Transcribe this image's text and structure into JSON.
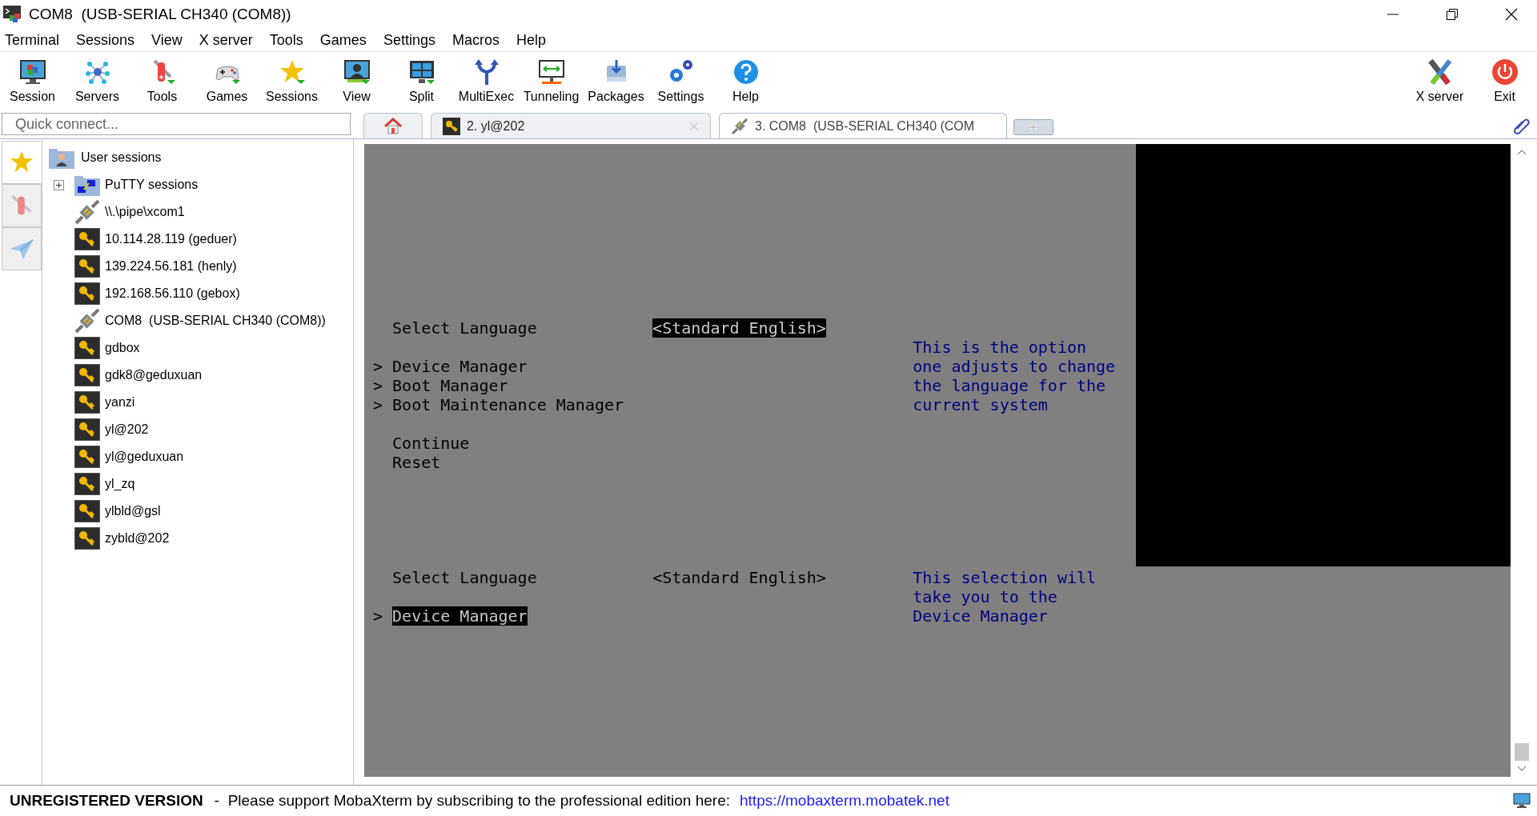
{
  "window": {
    "title": "COM8  (USB-SERIAL CH340 (COM8))"
  },
  "menu": [
    "Terminal",
    "Sessions",
    "View",
    "X server",
    "Tools",
    "Games",
    "Settings",
    "Macros",
    "Help"
  ],
  "toolbar": {
    "left": [
      {
        "label": "Session",
        "kind": "session"
      },
      {
        "label": "Servers",
        "kind": "servers"
      },
      {
        "label": "Tools",
        "kind": "tools"
      },
      {
        "label": "Games",
        "kind": "games"
      },
      {
        "label": "Sessions",
        "kind": "star"
      },
      {
        "label": "View",
        "kind": "view"
      },
      {
        "label": "Split",
        "kind": "split"
      },
      {
        "label": "MultiExec",
        "kind": "multiexec"
      },
      {
        "label": "Tunneling",
        "kind": "tunneling"
      },
      {
        "label": "Packages",
        "kind": "packages"
      },
      {
        "label": "Settings",
        "kind": "settings"
      },
      {
        "label": "Help",
        "kind": "help"
      }
    ],
    "right": [
      {
        "label": "X server",
        "kind": "xserver"
      },
      {
        "label": "Exit",
        "kind": "exit"
      }
    ]
  },
  "quick_connect": {
    "placeholder": "Quick connect..."
  },
  "side_tabs": [
    {
      "kind": "star",
      "selected": true
    },
    {
      "kind": "tools",
      "selected": false
    },
    {
      "kind": "send",
      "selected": false
    }
  ],
  "sessions_tree": {
    "label": "User sessions",
    "children": [
      {
        "label": "PuTTY sessions",
        "kind": "folder",
        "expanded": false
      },
      {
        "label": "\\\\.\\pipe\\xcom1",
        "kind": "serial"
      },
      {
        "label": "10.114.28.119 (geduer)",
        "kind": "ssh"
      },
      {
        "label": "139.224.56.181 (henly)",
        "kind": "ssh"
      },
      {
        "label": "192.168.56.110 (gebox)",
        "kind": "ssh"
      },
      {
        "label": "COM8  (USB-SERIAL CH340 (COM8))",
        "kind": "serial"
      },
      {
        "label": "gdbox",
        "kind": "ssh"
      },
      {
        "label": "gdk8@geduxuan",
        "kind": "ssh"
      },
      {
        "label": "yanzi",
        "kind": "ssh"
      },
      {
        "label": "yl@202",
        "kind": "ssh"
      },
      {
        "label": "yl@geduxuan",
        "kind": "ssh"
      },
      {
        "label": "yl_zq",
        "kind": "ssh"
      },
      {
        "label": "ylbld@gsl",
        "kind": "ssh"
      },
      {
        "label": "zybld@202",
        "kind": "ssh"
      }
    ]
  },
  "tabs": [
    {
      "kind": "home",
      "selected": false
    },
    {
      "label": "2. yl@202",
      "kind": "ssh",
      "selected": false
    },
    {
      "label": "3. COM8  (USB-SERIAL CH340 (COM",
      "kind": "serial",
      "selected": true
    }
  ],
  "terminal": {
    "rows": [
      {
        "kind": "text",
        "label": "Select Language",
        "label_highlighted": false,
        "value": "<Standard English>",
        "value_highlighted": true
      },
      {
        "kind": "text",
        "help": "This is the option"
      },
      {
        "kind": "text",
        "marker": ">",
        "label": "Device Manager",
        "label_highlighted": false,
        "help": "one adjusts to change"
      },
      {
        "kind": "text",
        "marker": ">",
        "label": "Boot Manager",
        "label_highlighted": false,
        "help": "the language for the"
      },
      {
        "kind": "text",
        "marker": ">",
        "label": "Boot Maintenance Manager",
        "label_highlighted": false,
        "help": "current system"
      },
      {
        "kind": "blank"
      },
      {
        "kind": "text",
        "label": "Continue",
        "label_highlighted": false
      },
      {
        "kind": "text",
        "label": "Reset",
        "label_highlighted": false
      },
      {
        "kind": "blank"
      },
      {
        "kind": "blank"
      },
      {
        "kind": "blank"
      },
      {
        "kind": "blank"
      },
      {
        "kind": "blank"
      },
      {
        "kind": "text",
        "label": "Select Language",
        "label_highlighted": false,
        "value": "<Standard English>",
        "value_highlighted": false,
        "help": "This selection will"
      },
      {
        "kind": "text",
        "help": "take you to the"
      },
      {
        "kind": "text",
        "marker": ">",
        "label": "Device Manager",
        "label_highlighted": true,
        "help": "Device Manager"
      }
    ]
  },
  "status_bar": {
    "notice": "UNREGISTERED VERSION",
    "message": "-  Please support MobaXterm by subscribing to the professional edition here:",
    "link": "https://mobaxterm.mobatek.net"
  }
}
